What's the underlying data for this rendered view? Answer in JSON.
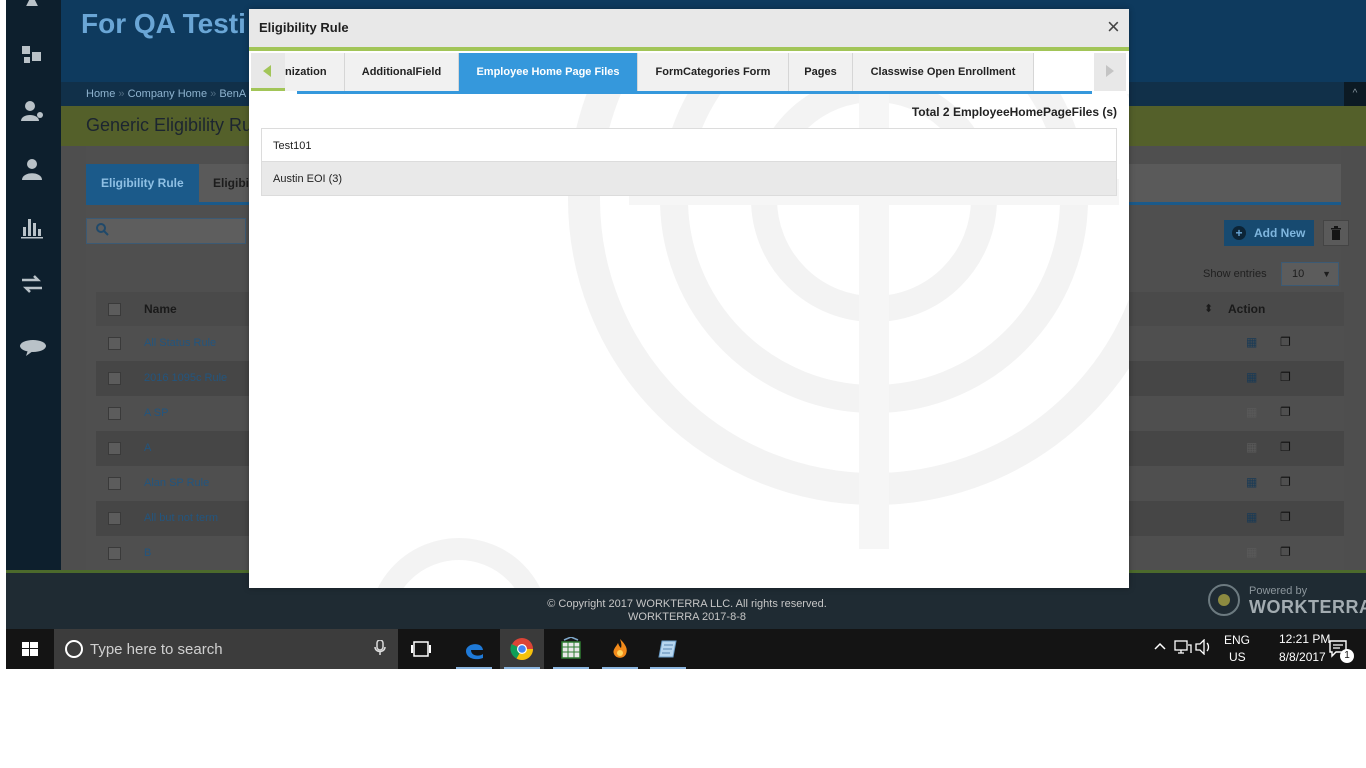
{
  "app": {
    "title": "For QA Testi",
    "breadcrumb": [
      "Home",
      "Company Home",
      "BenA"
    ],
    "breadcrumb_sep": "»",
    "page_heading": "Generic Eligibility Ru",
    "tabs": [
      "Eligibility Rule",
      "Eligibil"
    ],
    "add_new_label": "Add New",
    "show_entries_label": "Show entries",
    "entries_value": "10",
    "columns": {
      "name": "Name",
      "action": "Action"
    },
    "rows": [
      "All Status Rule",
      "2016 1095c Rule",
      "A SP",
      "A",
      "Alan SP Rule",
      "All but not term",
      "B"
    ]
  },
  "modal": {
    "title": "Eligibility Rule",
    "close": "×",
    "tabs": [
      "nization",
      "AdditionalField",
      "Employee Home Page Files",
      "FormCategories Form",
      "Pages",
      "Classwise Open Enrollment"
    ],
    "active_tab": "Employee Home Page Files",
    "total_label": "Total 2 EmployeeHomePageFiles (s)",
    "files": [
      "Test101",
      "Austin EOI (3)"
    ]
  },
  "footer": {
    "copyright": "© Copyright 2017 WORKTERRA LLC. All rights reserved.",
    "build": "WORKTERRA 2017-8-8",
    "powered_by": "Powered by",
    "brand": "WORKTERRA"
  },
  "taskbar": {
    "search_placeholder": "Type here to search",
    "lang_line1": "ENG",
    "lang_line2": "US",
    "time": "12:21 PM",
    "date": "8/8/2017",
    "notification_count": "1"
  },
  "icons": {
    "rail": [
      "puzzle-icon",
      "user-star-icon",
      "user-icon",
      "bar-chart-icon",
      "transfer-icon",
      "chat-icon"
    ],
    "taskbar_apps": [
      "edge-icon",
      "chrome-icon",
      "spreadsheet-icon",
      "flame-app-icon",
      "notes-app-icon"
    ]
  },
  "colors": {
    "accent_blue": "#3598dc",
    "accent_green": "#a2c558",
    "header_navy": "#0e3a5e"
  }
}
